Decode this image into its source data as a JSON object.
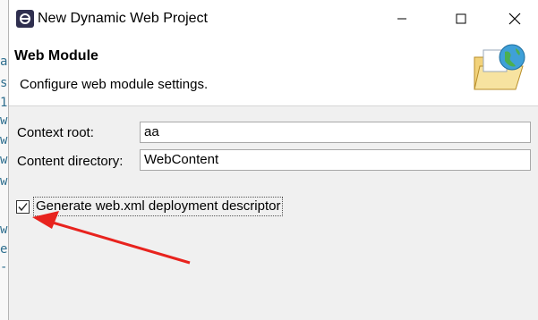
{
  "window": {
    "title": "New Dynamic Web Project"
  },
  "header": {
    "title": "Web Module",
    "description": "Configure web module settings."
  },
  "form": {
    "context_root_label": "Context root:",
    "context_root_value": "aa",
    "content_directory_label": "Content directory:",
    "content_directory_value": "WebContent",
    "generate_xml_label": "Generate web.xml deployment descriptor",
    "generate_xml_checked": true
  },
  "background": {
    "glyphs": [
      "a",
      "s",
      "1",
      "w",
      "w",
      "w",
      "w",
      "w",
      "e",
      "-"
    ]
  },
  "colors": {
    "annotation_arrow": "#e8231e",
    "dialog_bg": "#f0f0f0"
  }
}
